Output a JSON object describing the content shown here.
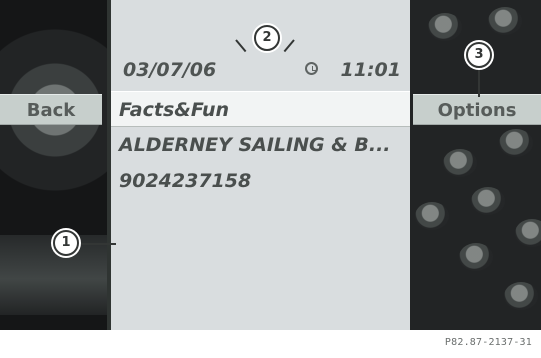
{
  "header": {
    "date": "03/07/06",
    "time": "11:01"
  },
  "softkeys": {
    "back": "Back",
    "options": "Options"
  },
  "menu": {
    "items": [
      {
        "label": "Facts&Fun"
      },
      {
        "label": "ALDERNEY SAILING & B..."
      },
      {
        "label": "9024237158"
      }
    ]
  },
  "callouts": {
    "one": "1",
    "two": "2",
    "three": "3"
  },
  "caption": {
    "code": "P82.87-2137-31"
  }
}
